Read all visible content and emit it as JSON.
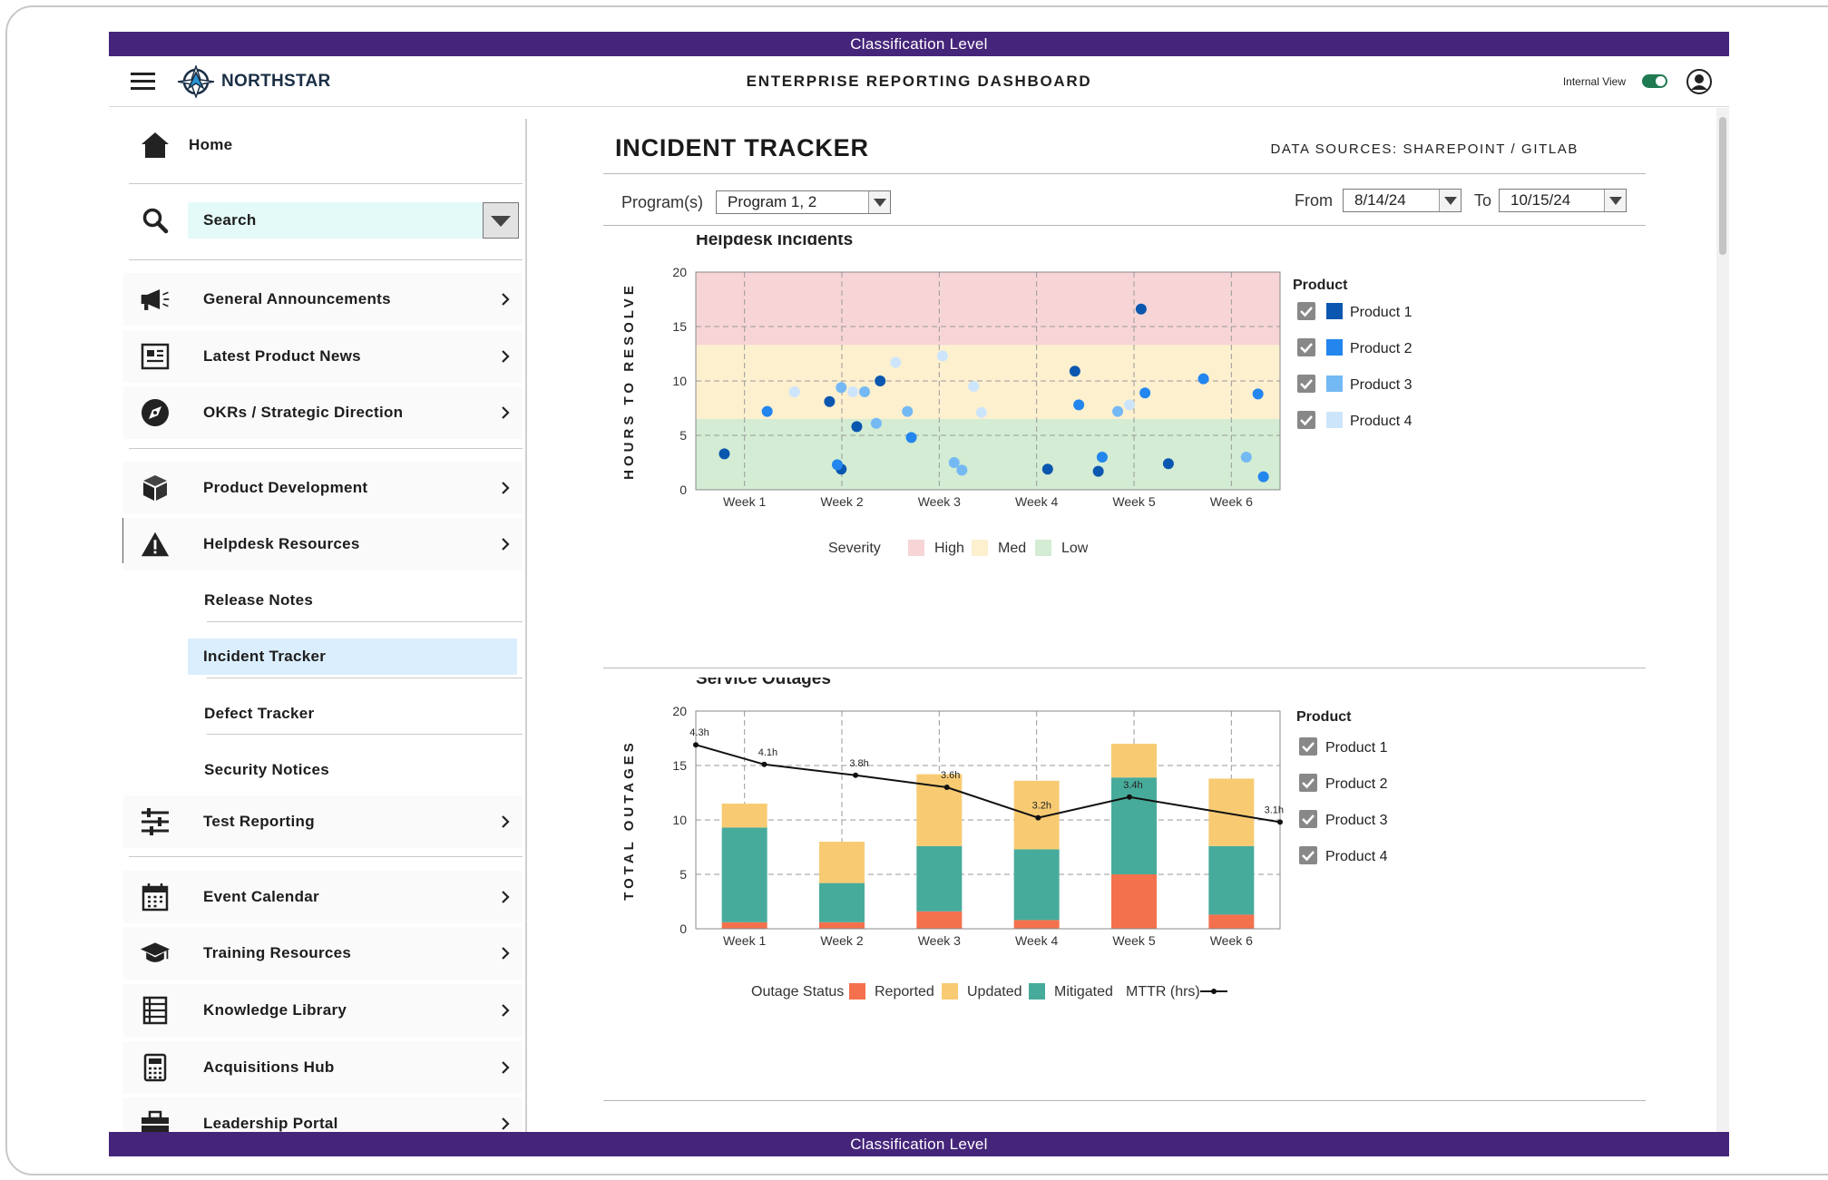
{
  "classification": {
    "top": "Classification Level",
    "bottom": "Classification Level"
  },
  "header": {
    "logo_text": "NORTHSTAR",
    "title": "ENTERPRISE REPORTING DASHBOARD",
    "internal_view_label": "Internal View"
  },
  "sidebar": {
    "home": "Home",
    "search": "Search",
    "items": [
      {
        "label": "General Announcements",
        "icon": "megaphone-icon"
      },
      {
        "label": "Latest Product News",
        "icon": "newspaper-icon"
      },
      {
        "label": "OKRs / Strategic Direction",
        "icon": "compass-icon"
      },
      {
        "label": "Product Development",
        "icon": "cube-icon"
      },
      {
        "label": "Helpdesk Resources",
        "icon": "warning-icon"
      },
      {
        "label": "Test Reporting",
        "icon": "sliders-icon"
      },
      {
        "label": "Event Calendar",
        "icon": "calendar-icon"
      },
      {
        "label": "Training Resources",
        "icon": "graduation-cap-icon"
      },
      {
        "label": "Knowledge Library",
        "icon": "book-icon"
      },
      {
        "label": "Acquisitions Hub",
        "icon": "calculator-icon"
      },
      {
        "label": "Leadership Portal",
        "icon": "briefcase-icon"
      }
    ],
    "sub_items": [
      "Release Notes",
      "Incident Tracker",
      "Defect Tracker",
      "Security Notices"
    ],
    "active_sub_item": "Incident Tracker"
  },
  "main": {
    "title": "INCIDENT TRACKER",
    "data_sources": "DATA SOURCES: SHAREPOINT / GITLAB",
    "filters": {
      "program_label": "Program(s)",
      "program_value": "Program 1, 2",
      "from_label": "From",
      "from_value": "8/14/24",
      "to_label": "To",
      "to_value": "10/15/24"
    }
  },
  "colors": {
    "product1": "#0b57b0",
    "product2": "#2286ee",
    "product3": "#74b9f4",
    "product4": "#cde5fb",
    "high": "#f7d5d7",
    "med": "#fdf0cf",
    "low": "#d3ecd3",
    "reported": "#f4714d",
    "updated": "#f8cb73",
    "mitigated": "#47ab9b",
    "brand": "#45257a"
  },
  "chart_data": [
    {
      "type": "scatter",
      "title": "Helpdesk Incidents",
      "ylabel": "HOURS TO RESOLVE",
      "xlabel": "",
      "categories": [
        "Week 1",
        "Week 2",
        "Week 3",
        "Week 4",
        "Week 5",
        "Week 6"
      ],
      "ylim": [
        0,
        20
      ],
      "yticks": [
        0,
        5,
        10,
        15,
        20
      ],
      "grid": true,
      "legend_title": "Product",
      "severity_bands": {
        "legend_title": "Severity",
        "bands": [
          {
            "name": "High",
            "from": 13.3,
            "to": 20
          },
          {
            "name": "Med",
            "from": 6.5,
            "to": 13.3
          },
          {
            "name": "Low",
            "from": 0,
            "to": 6.5
          }
        ]
      },
      "series": [
        {
          "name": "Product 1",
          "points": [
            [
              0.25,
              3.3
            ],
            [
              1.6,
              8.1
            ],
            [
              1.95,
              5.8
            ],
            [
              1.75,
              1.9
            ],
            [
              2.25,
              10.0
            ],
            [
              4.4,
              1.9
            ],
            [
              4.75,
              10.9
            ],
            [
              5.05,
              1.7
            ],
            [
              5.6,
              16.6
            ],
            [
              5.95,
              2.4
            ]
          ]
        },
        {
          "name": "Product 2",
          "points": [
            [
              0.8,
              7.2
            ],
            [
              1.7,
              2.3
            ],
            [
              2.65,
              4.8
            ],
            [
              4.8,
              7.8
            ],
            [
              5.1,
              3.0
            ],
            [
              5.65,
              8.9
            ],
            [
              6.4,
              10.2
            ],
            [
              7.1,
              8.8
            ],
            [
              7.17,
              1.2
            ]
          ]
        },
        {
          "name": "Product 3",
          "points": [
            [
              1.75,
              9.4
            ],
            [
              2.05,
              9.0
            ],
            [
              2.2,
              6.1
            ],
            [
              2.6,
              7.2
            ],
            [
              3.2,
              2.5
            ],
            [
              3.3,
              1.8
            ],
            [
              5.3,
              7.2
            ],
            [
              6.95,
              3.0
            ]
          ]
        },
        {
          "name": "Product 4",
          "points": [
            [
              1.15,
              9.0
            ],
            [
              1.9,
              9.0
            ],
            [
              2.45,
              11.7
            ],
            [
              3.05,
              12.3
            ],
            [
              3.45,
              9.5
            ],
            [
              3.55,
              7.1
            ],
            [
              5.45,
              7.8
            ]
          ]
        }
      ]
    },
    {
      "type": "bar",
      "stacked": true,
      "title": "Service Outages",
      "ylabel": "TOTAL OUTAGES",
      "xlabel": "",
      "categories": [
        "Week 1",
        "Week 2",
        "Week 3",
        "Week 4",
        "Week 5",
        "Week 6"
      ],
      "ylim": [
        0,
        20
      ],
      "yticks": [
        0,
        5,
        10,
        15,
        20
      ],
      "grid": true,
      "legend_title": "Outage Status",
      "product_legend_title": "Product",
      "products": [
        "Product 1",
        "Product 2",
        "Product 3",
        "Product 4"
      ],
      "series": [
        {
          "name": "Reported",
          "values": [
            0.6,
            0.6,
            1.6,
            0.8,
            5.0,
            1.3
          ]
        },
        {
          "name": "Updated",
          "values": [
            2.2,
            3.8,
            6.6,
            6.3,
            3.1,
            6.2
          ]
        },
        {
          "name": "Mitigated",
          "values": [
            8.7,
            3.6,
            6.0,
            6.5,
            8.9,
            6.3
          ]
        }
      ],
      "line": {
        "name": "MTTR (hrs)",
        "x": [
          0.0,
          0.75,
          1.75,
          2.75,
          3.75,
          4.75,
          6.4
        ],
        "values": [
          16.9,
          15.1,
          14.1,
          13.0,
          10.2,
          12.1,
          9.8
        ],
        "labels": [
          "4.3h",
          "4.1h",
          "3.8h",
          "3.6h",
          "3.2h",
          "3.4h",
          "3.1h"
        ]
      }
    }
  ]
}
